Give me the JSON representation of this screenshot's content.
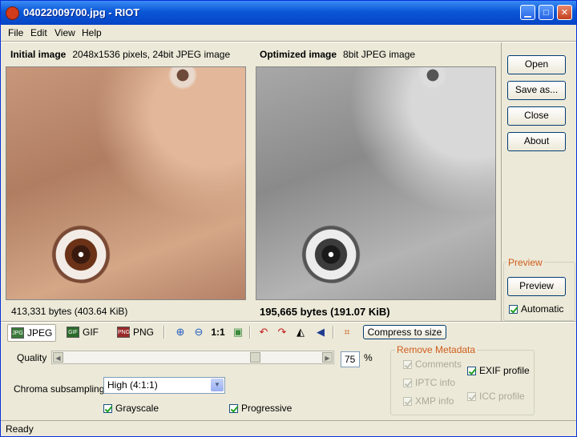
{
  "window": {
    "title": "04022009700.jpg - RIOT"
  },
  "menu": [
    "File",
    "Edit",
    "View",
    "Help"
  ],
  "initial": {
    "label": "Initial image",
    "info": "2048x1536 pixels, 24bit JPEG image",
    "bytes": "413,331 bytes (403.64 KiB)"
  },
  "optimized": {
    "label": "Optimized image",
    "info": "8bit JPEG image",
    "bytes": "195,665 bytes (191.07 KiB)"
  },
  "side_buttons": {
    "open": "Open",
    "save_as": "Save as...",
    "close": "Close",
    "about": "About"
  },
  "preview_group": {
    "title": "Preview",
    "button": "Preview",
    "automatic": "Automatic",
    "automatic_checked": true
  },
  "toolbar": {
    "jpeg": "JPEG",
    "gif": "GIF",
    "png": "PNG",
    "one_to_one": "1:1",
    "compress": "Compress to size"
  },
  "quality": {
    "label": "Quality",
    "value": "75",
    "unit": "%",
    "level": 0.75
  },
  "chroma": {
    "label": "Chroma subsampling",
    "selected": "High (4:1:1)"
  },
  "options": {
    "grayscale": "Grayscale",
    "grayscale_checked": true,
    "progressive": "Progressive",
    "progressive_checked": true
  },
  "metadata": {
    "title": "Remove Metadata",
    "comments": "Comments",
    "exif": "EXIF profile",
    "iptc": "IPTC info",
    "icc": "ICC profile",
    "xmp": "XMP info"
  },
  "status": "Ready"
}
